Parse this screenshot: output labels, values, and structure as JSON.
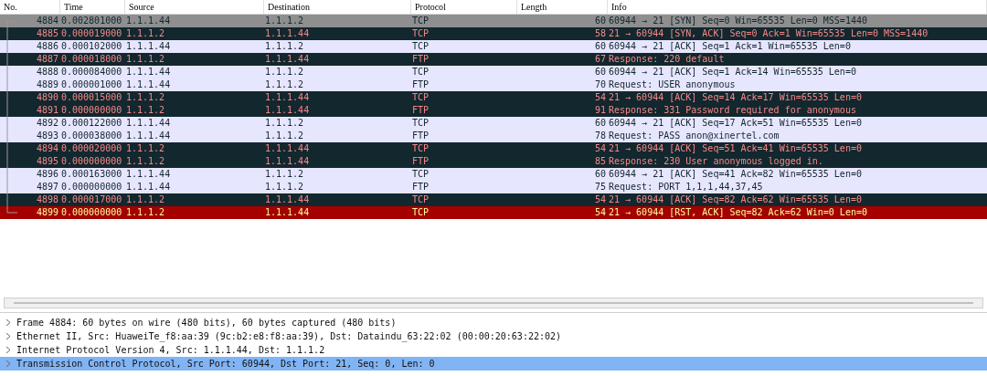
{
  "packet_list": {
    "columns": [
      "No.",
      "Time",
      "Source",
      "Destination",
      "Protocol",
      "Length",
      "Info"
    ],
    "rows": [
      {
        "no": "4884",
        "time": "0.002801000",
        "source": "1.1.1.44",
        "destination": "1.1.1.2",
        "protocol": "TCP",
        "length": "60",
        "info": "60944 → 21 [SYN] Seq=0 Win=65535 Len=0 MSS=1440",
        "kind": "client",
        "selected": true
      },
      {
        "no": "4885",
        "time": "0.000019000",
        "source": "1.1.1.2",
        "destination": "1.1.1.44",
        "protocol": "TCP",
        "length": "58",
        "info": "21 → 60944 [SYN, ACK] Seq=0 Ack=1 Win=65535 Len=0 MSS=1440",
        "kind": "server",
        "selected": false
      },
      {
        "no": "4886",
        "time": "0.000102000",
        "source": "1.1.1.44",
        "destination": "1.1.1.2",
        "protocol": "TCP",
        "length": "60",
        "info": "60944 → 21 [ACK] Seq=1 Ack=1 Win=65535 Len=0",
        "kind": "client",
        "selected": false
      },
      {
        "no": "4887",
        "time": "0.000018000",
        "source": "1.1.1.2",
        "destination": "1.1.1.44",
        "protocol": "FTP",
        "length": "67",
        "info": "Response: 220 default",
        "kind": "server",
        "selected": false
      },
      {
        "no": "4888",
        "time": "0.000084000",
        "source": "1.1.1.44",
        "destination": "1.1.1.2",
        "protocol": "TCP",
        "length": "60",
        "info": "60944 → 21 [ACK] Seq=1 Ack=14 Win=65535 Len=0",
        "kind": "client",
        "selected": false
      },
      {
        "no": "4889",
        "time": "0.000001000",
        "source": "1.1.1.44",
        "destination": "1.1.1.2",
        "protocol": "FTP",
        "length": "70",
        "info": "Request: USER anonymous",
        "kind": "client",
        "selected": false
      },
      {
        "no": "4890",
        "time": "0.000015000",
        "source": "1.1.1.2",
        "destination": "1.1.1.44",
        "protocol": "TCP",
        "length": "54",
        "info": "21 → 60944 [ACK] Seq=14 Ack=17 Win=65535 Len=0",
        "kind": "server",
        "selected": false
      },
      {
        "no": "4891",
        "time": "0.000000000",
        "source": "1.1.1.2",
        "destination": "1.1.1.44",
        "protocol": "FTP",
        "length": "91",
        "info": "Response: 331 Password required for anonymous",
        "kind": "server",
        "selected": false
      },
      {
        "no": "4892",
        "time": "0.000122000",
        "source": "1.1.1.44",
        "destination": "1.1.1.2",
        "protocol": "TCP",
        "length": "60",
        "info": "60944 → 21 [ACK] Seq=17 Ack=51 Win=65535 Len=0",
        "kind": "client",
        "selected": false
      },
      {
        "no": "4893",
        "time": "0.000038000",
        "source": "1.1.1.44",
        "destination": "1.1.1.2",
        "protocol": "FTP",
        "length": "78",
        "info": "Request: PASS anon@xinertel.com",
        "kind": "client",
        "selected": false
      },
      {
        "no": "4894",
        "time": "0.000020000",
        "source": "1.1.1.2",
        "destination": "1.1.1.44",
        "protocol": "TCP",
        "length": "54",
        "info": "21 → 60944 [ACK] Seq=51 Ack=41 Win=65535 Len=0",
        "kind": "server",
        "selected": false
      },
      {
        "no": "4895",
        "time": "0.000000000",
        "source": "1.1.1.2",
        "destination": "1.1.1.44",
        "protocol": "FTP",
        "length": "85",
        "info": "Response: 230 User anonymous logged in.",
        "kind": "server",
        "selected": false
      },
      {
        "no": "4896",
        "time": "0.000163000",
        "source": "1.1.1.44",
        "destination": "1.1.1.2",
        "protocol": "TCP",
        "length": "60",
        "info": "60944 → 21 [ACK] Seq=41 Ack=82 Win=65535 Len=0",
        "kind": "client",
        "selected": false
      },
      {
        "no": "4897",
        "time": "0.000000000",
        "source": "1.1.1.44",
        "destination": "1.1.1.2",
        "protocol": "FTP",
        "length": "75",
        "info": "Request: PORT 1,1,1,44,37,45",
        "kind": "client",
        "selected": false
      },
      {
        "no": "4898",
        "time": "0.000017000",
        "source": "1.1.1.2",
        "destination": "1.1.1.44",
        "protocol": "TCP",
        "length": "54",
        "info": "21 → 60944 [ACK] Seq=82 Ack=62 Win=65535 Len=0",
        "kind": "server",
        "selected": false
      },
      {
        "no": "4899",
        "time": "0.000000000",
        "source": "1.1.1.2",
        "destination": "1.1.1.44",
        "protocol": "TCP",
        "length": "54",
        "info": "21 → 60944 [RST, ACK] Seq=82 Ack=62 Win=0 Len=0",
        "kind": "reset",
        "selected": false
      }
    ]
  },
  "packet_details": [
    {
      "text": "Frame 4884: 60 bytes on wire (480 bits), 60 bytes captured (480 bits)",
      "selected": false
    },
    {
      "text": "Ethernet II, Src: HuaweiTe_f8:aa:39 (9c:b2:e8:f8:aa:39), Dst: Dataindu_63:22:02 (00:00:20:63:22:02)",
      "selected": false
    },
    {
      "text": "Internet Protocol Version 4, Src: 1.1.1.44, Dst: 1.1.1.2",
      "selected": false
    },
    {
      "text": "Transmission Control Protocol, Src Port: 60944, Dst Port: 21, Seq: 0, Len: 0",
      "selected": true
    }
  ]
}
